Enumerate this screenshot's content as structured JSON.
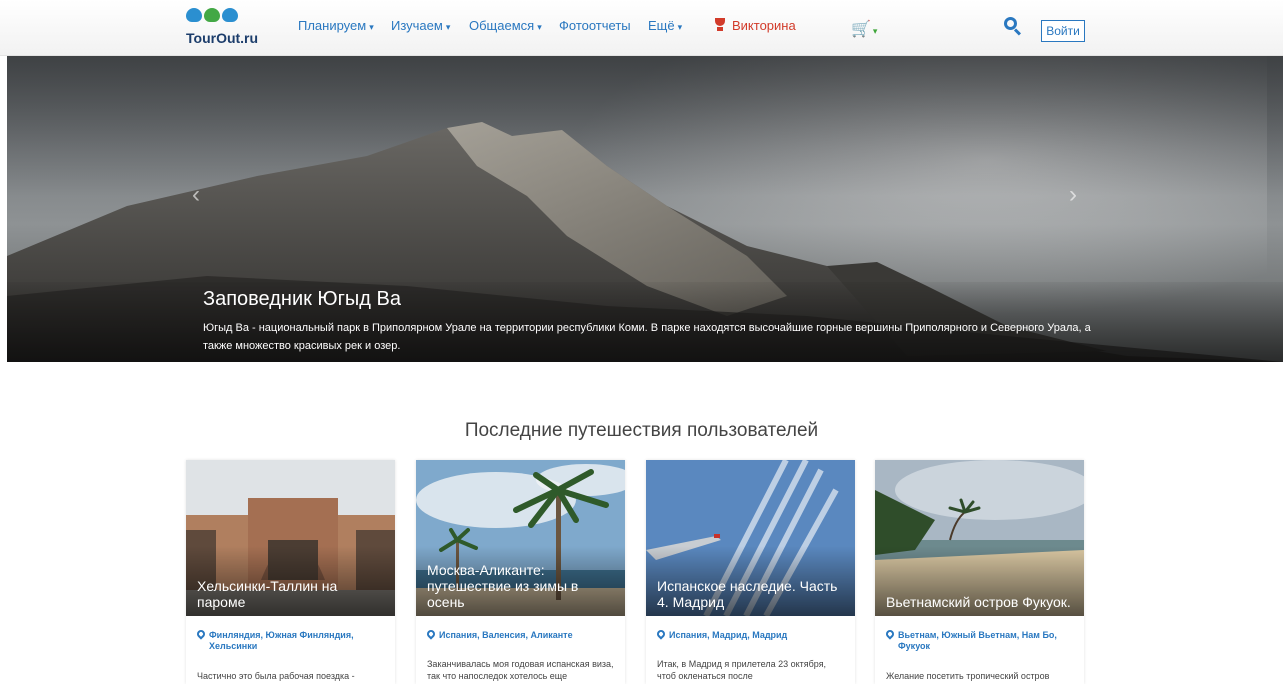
{
  "logo": {
    "text": "TourOut.ru"
  },
  "nav": {
    "items": [
      {
        "label": "Планируем",
        "caret": "▾"
      },
      {
        "label": "Изучаем",
        "caret": "▾"
      },
      {
        "label": "Общаемся",
        "caret": "▾"
      },
      {
        "label": "Фотоотчеты",
        "caret": ""
      },
      {
        "label": "Ещё",
        "caret": "▾"
      }
    ],
    "quiz_label": "Викторина",
    "cart_icon": "cart-icon",
    "login_label": "Войти"
  },
  "hero": {
    "title": "Заповедник Югыд Ва",
    "description": "Югыд Ва - национальный парк в Приполярном Урале на территории республики Коми. В парке находятся высочайшие горные вершины Приполярного и Северного Урала, а также множество красивых рек и озер.",
    "prev_arrow": "‹",
    "next_arrow": "›"
  },
  "section": {
    "title": "Последние путешествия пользователей",
    "cards": [
      {
        "title": "Хельсинки-Таллин на пароме",
        "location": "Финляндия, Южная Финляндия, Хельсинки",
        "excerpt": "Частично это была рабочая поездка -"
      },
      {
        "title": "Москва-Аликанте: путешествие из зимы в осень",
        "location": "Испания, Валенсия, Аликанте",
        "excerpt": "Заканчивалась моя годовая испанская виза, так что напоследок хотелось еще"
      },
      {
        "title": "Испанское наследие. Часть 4. Мадрид",
        "location": "Испания, Мадрид, Мадрид",
        "excerpt": "Итак, в Мадрид я прилетела 23 октября, чтоб окленаться после"
      },
      {
        "title": "Вьетнамский остров Фукуок.",
        "location": "Вьетнам, Южный Вьетнам, Нам Бо, Фукуок",
        "excerpt": "Желание посетить тропический остров"
      }
    ]
  }
}
